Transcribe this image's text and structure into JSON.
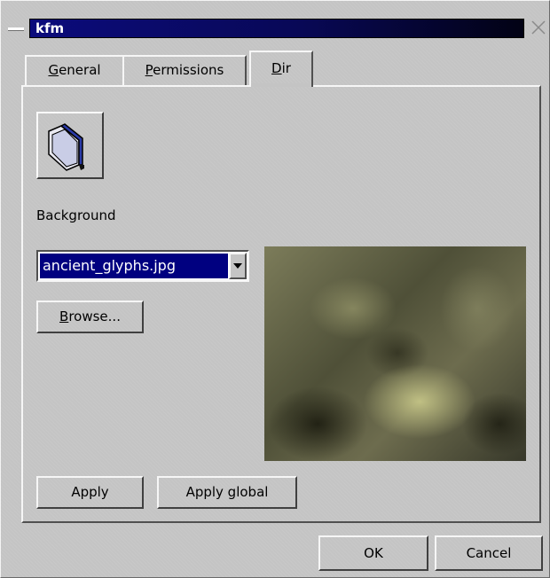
{
  "window": {
    "title": "kfm",
    "close_icon": "close-icon",
    "menu_icon": "window-menu-icon"
  },
  "tabs": [
    {
      "label": "General",
      "mnemonic": "G",
      "rest": "eneral",
      "active": false
    },
    {
      "label": "Permissions",
      "mnemonic": "P",
      "rest": "ermissions",
      "active": false
    },
    {
      "label": "Dir",
      "mnemonic": "D",
      "rest": "ir",
      "active": true
    }
  ],
  "dir": {
    "icon": "folder-icon",
    "background_label": "Background",
    "background_value": "ancient_glyphs.jpg",
    "browse_label": "Browse...",
    "browse_mnemonic": "B",
    "browse_rest": "rowse...",
    "preview_icon": "background-preview-image",
    "apply_label": "Apply",
    "apply_global_label": "Apply global"
  },
  "footer": {
    "ok_label": "OK",
    "cancel_label": "Cancel"
  },
  "colors": {
    "titlebar_start": "#0b0b7c",
    "titlebar_end": "#020214",
    "selection": "#000080",
    "face": "#c4c4c4"
  }
}
